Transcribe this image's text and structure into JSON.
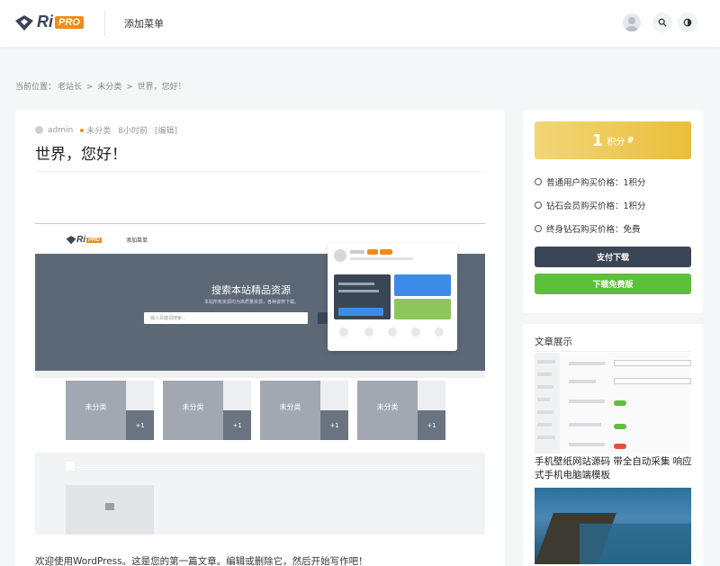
{
  "header": {
    "logo_text": "Ri",
    "logo_pro": "PRO",
    "nav_label": "添加菜单"
  },
  "breadcrumb": {
    "prefix": "当前位置：",
    "home": "老站长",
    "sep": ">",
    "category": "未分类",
    "current": "世界，您好！"
  },
  "post": {
    "author": "admin",
    "category": "未分类",
    "time": "8小时前",
    "edit": "[编辑]",
    "title": "世界，您好！",
    "body": "欢迎使用WordPress。这是您的第一篇文章。编辑或删除它，然后开始写作吧！"
  },
  "embedded": {
    "logo_text": "Ri",
    "logo_pro": "PRO",
    "nav": "添加菜单",
    "hero_title": "搜索本站精品资源",
    "hero_sub": "本站所有资源均为高质量资源，各种姿势下载。",
    "search_placeholder": "输入关键词搜索...",
    "thumb_label": "未分类",
    "thumb_count": "+1"
  },
  "sidebar": {
    "price_num": "1",
    "price_unit": "积分",
    "price_coin": "₽",
    "prices": [
      {
        "label": "普通用户购买价格：",
        "value": "1积分"
      },
      {
        "label": "钻石会员购买价格：",
        "value": "1积分"
      },
      {
        "label": "终身钻石购买价格：",
        "value": "免费"
      }
    ],
    "pay_button": "支付下载",
    "free_button": "下载免费版",
    "showcase_title": "文章展示",
    "article1_title": "手机壁纸网站源码 带全自动采集 响应式手机电脑端模板"
  },
  "colors": {
    "accent": "#f08a1b",
    "dark": "#3a4556",
    "green": "#5dbf3a",
    "gold": "#e9bf3b"
  }
}
